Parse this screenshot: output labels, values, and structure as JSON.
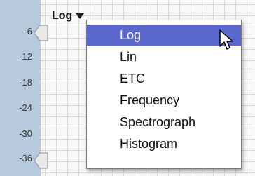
{
  "scale": {
    "labels": [
      "-6",
      "-12",
      "-18",
      "-24",
      "-30",
      "-36"
    ]
  },
  "select": {
    "current": "Log"
  },
  "menu": {
    "items": [
      "Log",
      "Lin",
      "ETC",
      "Frequency",
      "Spectrograph",
      "Histogram"
    ],
    "selected": "Log"
  },
  "colors": {
    "gutter": "#b7c9dd",
    "highlight": "#5a67cd"
  },
  "icons": [
    "slider-thumb-icon",
    "dropdown-caret-icon",
    "mouse-pointer-icon"
  ]
}
